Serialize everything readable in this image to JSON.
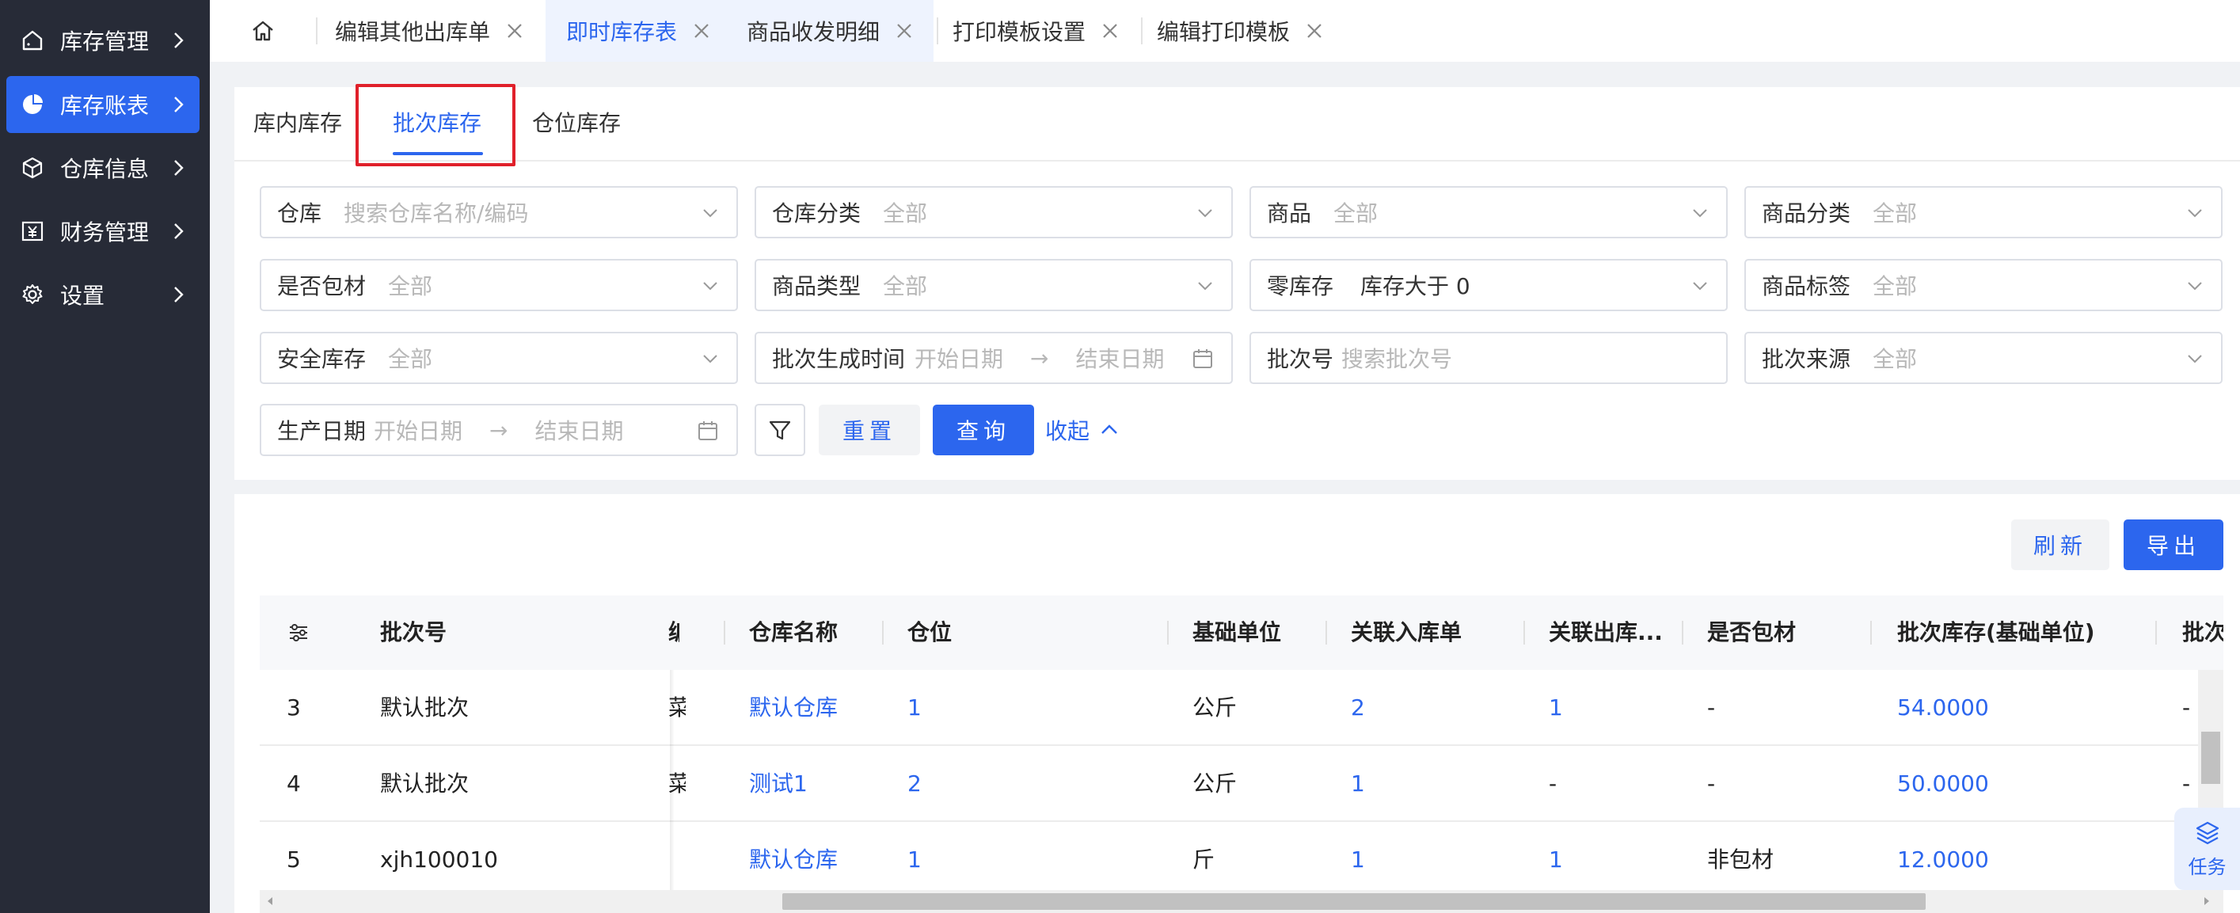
{
  "sidebar": {
    "items": [
      {
        "label": "库存管理",
        "icon": "home-icon"
      },
      {
        "label": "库存账表",
        "icon": "pie-chart-icon",
        "active": true
      },
      {
        "label": "仓库信息",
        "icon": "cube-icon"
      },
      {
        "label": "财务管理",
        "icon": "yen-icon"
      },
      {
        "label": "设置",
        "icon": "gear-icon"
      }
    ]
  },
  "tabs": [
    {
      "label": "编辑其他出库单"
    },
    {
      "label": "即时库存表",
      "active": true
    },
    {
      "label": "商品收发明细"
    },
    {
      "label": "打印模板设置"
    },
    {
      "label": "编辑打印模板"
    }
  ],
  "subtabs": [
    {
      "label": "库内库存"
    },
    {
      "label": "批次库存",
      "active": true
    },
    {
      "label": "仓位库存"
    }
  ],
  "filters": {
    "warehouse": {
      "label": "仓库",
      "placeholder": "搜索仓库名称/编码"
    },
    "warehouse_category": {
      "label": "仓库分类",
      "placeholder": "全部"
    },
    "product": {
      "label": "商品",
      "placeholder": "全部"
    },
    "product_category": {
      "label": "商品分类",
      "placeholder": "全部"
    },
    "is_packaging": {
      "label": "是否包材",
      "placeholder": "全部"
    },
    "product_type": {
      "label": "商品类型",
      "placeholder": "全部"
    },
    "zero_stock": {
      "label": "零库存",
      "value": "库存大于 0"
    },
    "product_tag": {
      "label": "商品标签",
      "placeholder": "全部"
    },
    "safety_stock": {
      "label": "安全库存",
      "placeholder": "全部"
    },
    "batch_time": {
      "label": "批次生成时间",
      "start": "开始日期",
      "end": "结束日期"
    },
    "batch_no": {
      "label": "批次号",
      "placeholder": "搜索批次号"
    },
    "batch_source": {
      "label": "批次来源",
      "placeholder": "全部"
    },
    "production_date": {
      "label": "生产日期",
      "start": "开始日期",
      "end": "结束日期"
    }
  },
  "actions": {
    "reset": "重置",
    "query": "查询",
    "collapse": "收起",
    "refresh": "刷新",
    "export": "导出"
  },
  "table": {
    "columns": {
      "batch_no": "批次号",
      "partial": "编",
      "warehouse": "仓库名称",
      "location": "仓位",
      "base_unit": "基础单位",
      "inbound": "关联入库单",
      "outbound": "关联出库...",
      "is_packaging": "是否包材",
      "batch_stock": "批次库存(基础单位)",
      "next": "批次"
    },
    "rows": [
      {
        "idx": "3",
        "batch_no": "默认批次",
        "partial": "菜",
        "warehouse": "默认仓库",
        "location": "1",
        "base_unit": "公斤",
        "inbound": "2",
        "outbound": "1",
        "is_packaging": "-",
        "batch_stock": "54.0000",
        "next": "-"
      },
      {
        "idx": "4",
        "batch_no": "默认批次",
        "partial": "菜",
        "warehouse": "测试1",
        "location": "2",
        "base_unit": "公斤",
        "inbound": "1",
        "outbound": "-",
        "is_packaging": "-",
        "batch_stock": "50.0000",
        "next": "-"
      },
      {
        "idx": "5",
        "batch_no": "xjh100010",
        "partial": "",
        "warehouse": "默认仓库",
        "location": "1",
        "base_unit": "斤",
        "inbound": "1",
        "outbound": "1",
        "is_packaging": "非包材",
        "batch_stock": "12.0000",
        "next": ""
      }
    ]
  },
  "task_button": "任务"
}
